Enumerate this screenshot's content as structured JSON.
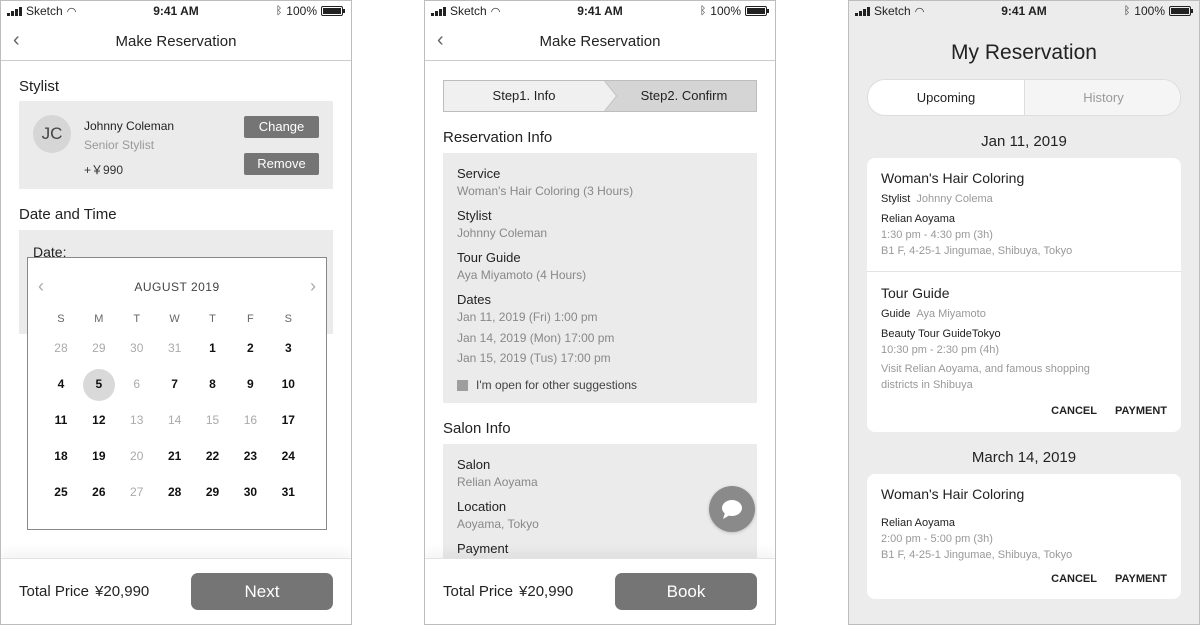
{
  "status": {
    "carrier": "Sketch",
    "time": "9:41 AM",
    "battery": "100%"
  },
  "screen1": {
    "nav_title": "Make Reservation",
    "stylist_section": "Stylist",
    "stylist": {
      "initials": "JC",
      "name": "Johnny Coleman",
      "role": "Senior Stylist",
      "price": "+￥990",
      "change_label": "Change",
      "remove_label": "Remove"
    },
    "datetime_section": "Date and Time",
    "date_label": "Date:",
    "calendar": {
      "month": "AUGUST 2019",
      "weekdays": [
        "S",
        "M",
        "T",
        "W",
        "T",
        "F",
        "S"
      ],
      "weeks": [
        [
          {
            "d": "28",
            "m": true
          },
          {
            "d": "29",
            "m": true
          },
          {
            "d": "30",
            "m": true
          },
          {
            "d": "31",
            "m": true
          },
          {
            "d": "1"
          },
          {
            "d": "2"
          },
          {
            "d": "3"
          }
        ],
        [
          {
            "d": "4"
          },
          {
            "d": "5",
            "sel": true
          },
          {
            "d": "6",
            "m": true
          },
          {
            "d": "7"
          },
          {
            "d": "8"
          },
          {
            "d": "9"
          },
          {
            "d": "10"
          }
        ],
        [
          {
            "d": "11"
          },
          {
            "d": "12"
          },
          {
            "d": "13",
            "m": true
          },
          {
            "d": "14",
            "m": true
          },
          {
            "d": "15",
            "m": true
          },
          {
            "d": "16",
            "m": true
          },
          {
            "d": "17"
          }
        ],
        [
          {
            "d": "18"
          },
          {
            "d": "19"
          },
          {
            "d": "20",
            "m": true
          },
          {
            "d": "21"
          },
          {
            "d": "22"
          },
          {
            "d": "23"
          },
          {
            "d": "24"
          }
        ],
        [
          {
            "d": "25"
          },
          {
            "d": "26"
          },
          {
            "d": "27",
            "m": true
          },
          {
            "d": "28"
          },
          {
            "d": "29"
          },
          {
            "d": "30"
          },
          {
            "d": "31"
          }
        ]
      ]
    },
    "total_label": "Total Price",
    "total_value": "¥20,990",
    "next_label": "Next"
  },
  "screen2": {
    "nav_title": "Make Reservation",
    "step1": "Step1. Info",
    "step2": "Step2. Confirm",
    "reservation_section": "Reservation Info",
    "service_label": "Service",
    "service_value": "Woman's Hair Coloring (3 Hours)",
    "stylist_label": "Stylist",
    "stylist_value": "Johnny Coleman",
    "guide_label": "Tour Guide",
    "guide_value": "Aya Miyamoto (4 Hours)",
    "dates_label": "Dates",
    "dates": [
      "Jan 11, 2019 (Fri) 1:00 pm",
      "Jan 14, 2019 (Mon) 17:00 pm",
      "Jan 15, 2019 (Tus) 17:00 pm"
    ],
    "suggestions_label": "I'm open for other suggestions",
    "salon_section": "Salon Info",
    "salon_label": "Salon",
    "salon_value": "Relian Aoyama",
    "location_label": "Location",
    "location_value": "Aoyama, Tokyo",
    "payment_label": "Payment",
    "total_label": "Total Price",
    "total_value": "¥20,990",
    "book_label": "Book"
  },
  "screen3": {
    "title": "My Reservation",
    "tab_upcoming": "Upcoming",
    "tab_history": "History",
    "date1": "Jan 11, 2019",
    "card1": {
      "title": "Woman's Hair Coloring",
      "meta_label": "Stylist",
      "meta_value": "Johnny Colema",
      "salon": "Relian Aoyama",
      "time": "1:30 pm - 4:30 pm (3h)",
      "address": "B1 F, 4-25-1 Jingumae, Shibuya, Tokyo",
      "title2": "Tour Guide",
      "meta2_label": "Guide",
      "meta2_value": "Aya Miyamoto",
      "tour": "Beauty Tour GuideTokyo",
      "time2": "10:30 pm - 2:30 pm (4h)",
      "desc": "Visit Relian Aoyama, and famous shopping districts in Shibuya",
      "cancel": "CANCEL",
      "payment": "PAYMENT"
    },
    "date2": "March 14, 2019",
    "card2": {
      "title": "Woman's Hair Coloring",
      "salon": "Relian Aoyama",
      "time": "2:00 pm - 5:00 pm (3h)",
      "address": "B1 F, 4-25-1 Jingumae, Shibuya, Tokyo",
      "cancel": "CANCEL",
      "payment": "PAYMENT"
    }
  }
}
